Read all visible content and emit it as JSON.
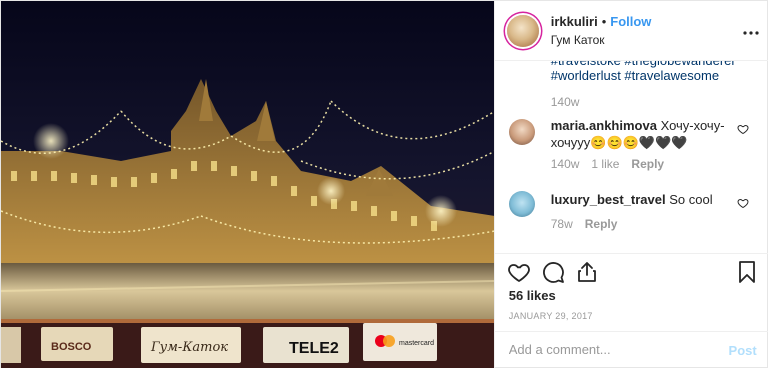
{
  "header": {
    "username": "irkkuliri",
    "separator": "•",
    "follow_label": "Follow",
    "location": "Гум Каток",
    "more_icon": "more-horizontal-icon"
  },
  "caption": {
    "tail_text": "#travelstoke #theglobewanderer #worlderlust #travelawesome",
    "time": "140w"
  },
  "comments": [
    {
      "username": "maria.ankhimova",
      "text": "Хочу-хочу-хочууу😊😊😊🖤🖤🖤",
      "time": "140w",
      "likes": "1 like",
      "reply": "Reply"
    },
    {
      "username": "luxury_best_travel",
      "text": "So cool",
      "time": "78w",
      "reply": "Reply"
    }
  ],
  "actions": {
    "like_icon": "heart-icon",
    "comment_icon": "comment-icon",
    "share_icon": "share-icon",
    "save_icon": "bookmark-icon"
  },
  "likes_text": "56 likes",
  "date_text": "January 29, 2017",
  "add_comment": {
    "placeholder": "Add a comment...",
    "post_label": "Post"
  },
  "photo": {
    "sign_tele2": "TELE2",
    "sign_gum": "Гум-Каток",
    "sign_mastercard": "mastercard",
    "sign_bosco": "BOSCO"
  }
}
